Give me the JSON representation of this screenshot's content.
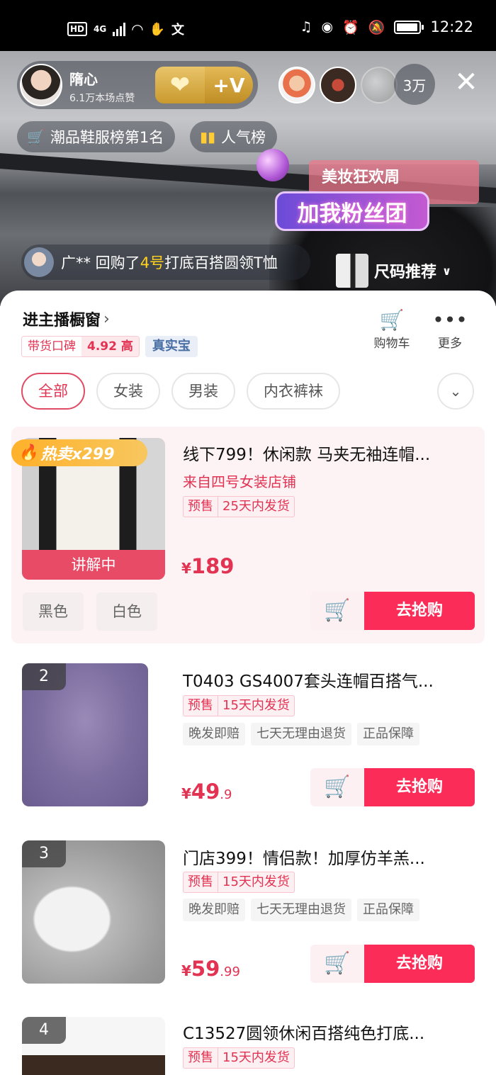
{
  "status_bar": {
    "left_icons": [
      "hd-icon",
      "4g-signal-icon",
      "wifi-icon",
      "hand-icon",
      "translate-icon"
    ],
    "hd": "HD",
    "network": "4G",
    "time": "12:22"
  },
  "live": {
    "host_name": "隋心",
    "host_likes": "6.1万本场点赞",
    "viewer_count": "3万",
    "tags": [
      {
        "label": "潮品鞋服榜第1名",
        "icon": "cart-icon"
      },
      {
        "label": "人气榜",
        "icon": "bar-chart-icon"
      }
    ],
    "promo": {
      "top": "美妆狂欢周",
      "main": "加我粉丝团"
    },
    "ticker": {
      "prefix": "广** 回购了",
      "highlight": "4号",
      "suffix": "打底百搭圆领T恤"
    },
    "size_recommend": "尺码推荐"
  },
  "store": {
    "title": "进主播橱窗",
    "rating_label": "带货口碑",
    "rating_value": "4.92 高",
    "real_badge": "真实宝",
    "actions": [
      {
        "label": "购物车",
        "icon": "cart-icon"
      },
      {
        "label": "更多",
        "icon": "more-icon"
      }
    ]
  },
  "filters": [
    "全部",
    "女装",
    "男装",
    "内衣裤袜"
  ],
  "products": [
    {
      "hot_label": "热卖x299",
      "status": "讲解中",
      "title": "线下799！休闲款 马夹无袖连帽...",
      "shop": "来自四号女装店铺",
      "presale": "预售",
      "ship": "25天内发货",
      "price_cur": "¥",
      "price_int": "189",
      "price_dec": "",
      "colors": [
        "黑色",
        "白色"
      ],
      "buy": "去抢购"
    },
    {
      "rank": "2",
      "title": "T0403 GS4007套头连帽百搭气...",
      "presale": "预售",
      "ship": "15天内发货",
      "services": [
        "晚发即赔",
        "七天无理由退货",
        "正品保障"
      ],
      "price_cur": "¥",
      "price_int": "49",
      "price_dec": ".9",
      "buy": "去抢购"
    },
    {
      "rank": "3",
      "title": "门店399！情侣款！加厚仿羊羔...",
      "presale": "预售",
      "ship": "15天内发货",
      "services": [
        "晚发即赔",
        "七天无理由退货",
        "正品保障"
      ],
      "price_cur": "¥",
      "price_int": "59",
      "price_dec": ".99",
      "buy": "去抢购"
    },
    {
      "rank": "4",
      "title": "C13527圆领休闲百搭纯色打底...",
      "presale": "预售",
      "ship": "15天内发货"
    }
  ],
  "colors": {
    "accent": "#fb2c57",
    "accent_text": "#e23353",
    "ticker_highlight": "#ffd21f"
  }
}
